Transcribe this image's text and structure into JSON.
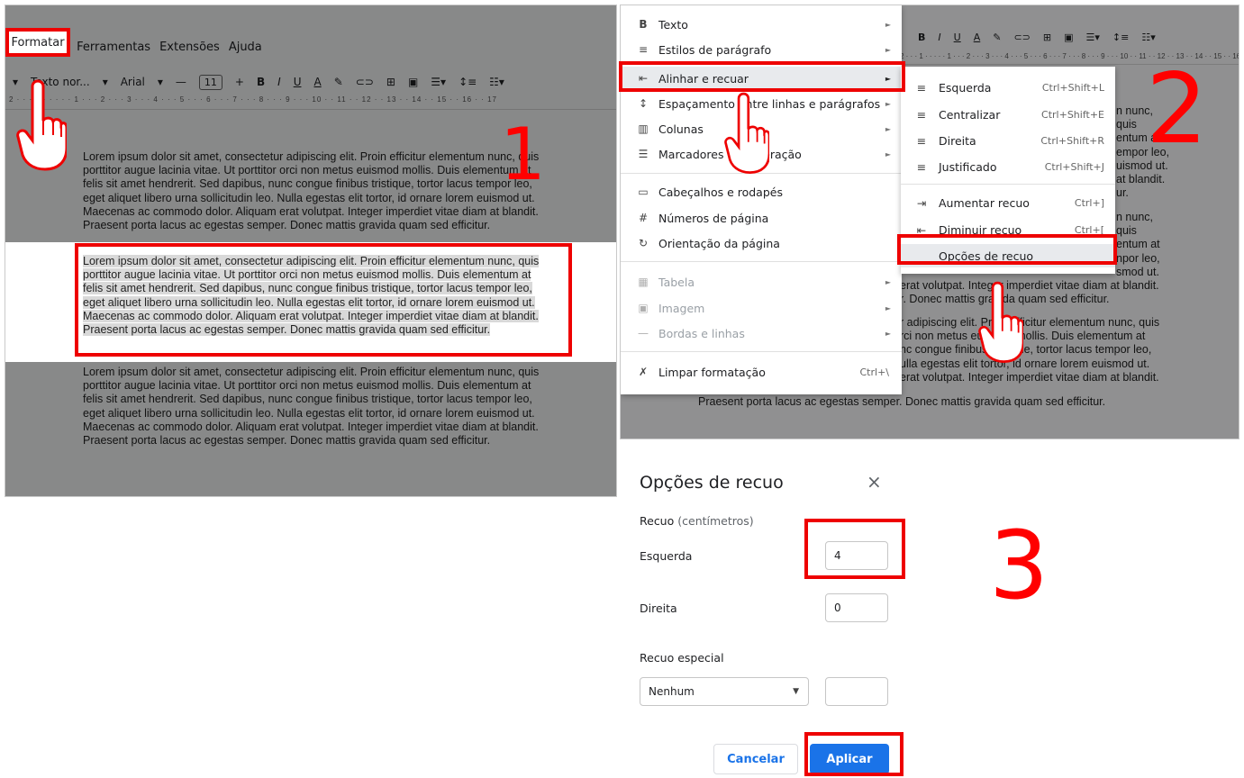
{
  "docs": {
    "menubar": [
      "Formatar",
      "Ferramentas",
      "Extensões",
      "Ajuda"
    ],
    "toolbar": {
      "style": "Texto nor...",
      "font": "Arial",
      "size": "11",
      "bold": "B",
      "italic": "I",
      "underline": "U",
      "color": "A"
    },
    "ruler": "2 · · · 1 · · · · · 1 · · · 2 · · · 3 · · · 4 · · · 5 · · · 6 · · · 7 · · · 8 · · · 9 · · · 10 · · 11 · · 12 · · 13 · · 14 · · 15 · · 16 · · 17",
    "paragraph_lines": [
      "Lorem ipsum dolor sit amet, consectetur adipiscing elit. Proin efficitur elementum nunc, quis",
      "porttitor augue lacinia vitae. Ut porttitor orci non metus euismod mollis. Duis elementum at",
      "felis sit amet hendrerit. Sed dapibus, nunc congue finibus tristique, tortor lacus tempor leo,",
      "eget aliquet libero urna sollicitudin leo. Nulla egestas elit tortor, id ornare lorem euismod ut.",
      "Maecenas ac commodo dolor. Aliquam erat volutpat. Integer imperdiet vitae diam at blandit.",
      "Praesent porta lacus ac egestas semper. Donec mattis gravida quam sed efficitur."
    ]
  },
  "format_menu": {
    "items": [
      {
        "icon": "B",
        "label": "Texto",
        "arrow": "►"
      },
      {
        "icon": "≡",
        "label": "Estilos de parágrafo",
        "arrow": "►"
      },
      {
        "icon": "⇤",
        "label": "Alinhar e recuar",
        "arrow": "►"
      },
      {
        "icon": "↕",
        "label": "Espaçamento entre linhas e parágrafos",
        "arrow": "►"
      },
      {
        "icon": "▥",
        "label": "Colunas",
        "arrow": "►"
      },
      {
        "icon": "☰",
        "label": "Marcadores e numeração",
        "arrow": "►"
      },
      {
        "icon": "▭",
        "label": "Cabeçalhos e rodapés"
      },
      {
        "icon": "#",
        "label": "Números de página"
      },
      {
        "icon": "↻",
        "label": "Orientação da página"
      },
      {
        "icon": "▦",
        "label": "Tabela",
        "arrow": "►"
      },
      {
        "icon": "▣",
        "label": "Imagem",
        "arrow": "►"
      },
      {
        "icon": "—",
        "label": "Bordas e linhas",
        "arrow": "►"
      },
      {
        "icon": "✗",
        "label": "Limpar formatação",
        "shortcut": "Ctrl+\\"
      }
    ]
  },
  "align_submenu": {
    "items": [
      {
        "icon": "≡",
        "label": "Esquerda",
        "shortcut": "Ctrl+Shift+L"
      },
      {
        "icon": "≡",
        "label": "Centralizar",
        "shortcut": "Ctrl+Shift+E"
      },
      {
        "icon": "≡",
        "label": "Direita",
        "shortcut": "Ctrl+Shift+R"
      },
      {
        "icon": "≡",
        "label": "Justificado",
        "shortcut": "Ctrl+Shift+J"
      },
      {
        "icon": "⇥",
        "label": "Aumentar recuo",
        "shortcut": "Ctrl+]"
      },
      {
        "icon": "⇤",
        "label": "Diminuir recuo",
        "shortcut": "Ctrl+["
      },
      {
        "label": "Opções de recuo"
      }
    ]
  },
  "bg_doc_lines": [
    "n nunc, quis",
    "entum at",
    "empor leo,",
    "uismod ut.",
    "at blandit.",
    "ur.",
    "n nunc, quis",
    "entum at",
    "npor leo,",
    "smod ut.",
    "erat volutpat. Integer imperdiet vitae diam at blandit.",
    "r. Donec mattis gravida quam sed efficitur.",
    "r adipiscing elit. Proin efficitur elementum nunc, quis",
    "rci non metus euismod mollis. Duis elementum at",
    "nc congue finibus tristique, tortor lacus tempor leo,",
    "ulla egestas elit tortor, id ornare lorem euismod ut.",
    "erat volutpat. Integer imperdiet vitae diam at blandit.",
    "Praesent porta lacus ac egestas semper. Donec mattis gravida quam sed efficitur."
  ],
  "dialog": {
    "title": "Opções de recuo",
    "close": "×",
    "section": "Recuo",
    "unit": "(centímetros)",
    "left_label": "Esquerda",
    "left_value": "4",
    "right_label": "Direita",
    "right_value": "0",
    "special_label": "Recuo especial",
    "special_value": "Nenhum",
    "special_amount": "",
    "cancel": "Cancelar",
    "apply": "Aplicar"
  },
  "steps": [
    "1",
    "2",
    "3"
  ],
  "colors": {
    "annotation_red": "#ee0000",
    "apply_blue": "#1a73e8"
  }
}
